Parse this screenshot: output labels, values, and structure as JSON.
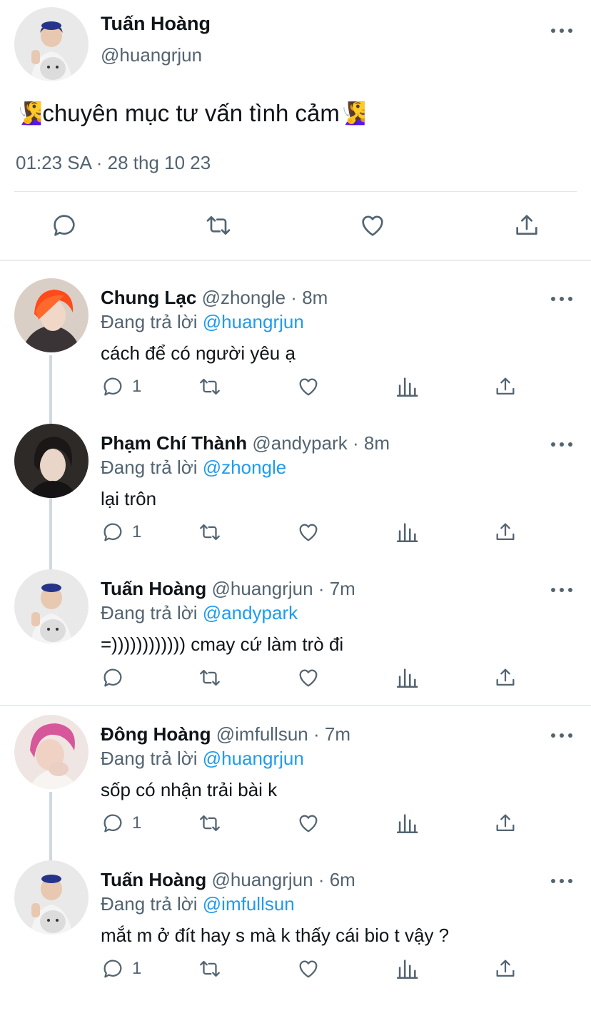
{
  "main_tweet": {
    "name": "Tuấn Hoàng",
    "handle": "@huangrjun",
    "text": "chuyên mục tư vấn tình cảm",
    "emoji_left": "🧏‍♀️",
    "emoji_right": "🧏‍♀️",
    "meta": "01:23 SA · 28 thg 10 23",
    "actions": [
      "reply-icon",
      "retweet-icon",
      "like-icon",
      "share-icon"
    ]
  },
  "replies": [
    {
      "name": "Chung Lạc",
      "handle": "@zhongle",
      "dot": "·",
      "time": "8m",
      "replying_prefix": "Đang trả lời ",
      "replying_to": "@huangrjun",
      "text": "cách để có người yêu ạ",
      "reply_count": "1"
    },
    {
      "name": "Phạm Chí Thành",
      "handle": "@andypark",
      "dot": "·",
      "time": "8m",
      "replying_prefix": "Đang trả lời ",
      "replying_to": "@zhongle",
      "text": "lại trôn",
      "reply_count": "1"
    },
    {
      "name": "Tuấn Hoàng",
      "handle": "@huangrjun",
      "dot": "·",
      "time": "7m",
      "replying_prefix": "Đang trả lời ",
      "replying_to": "@andypark",
      "text": "=)))))))))))) cmay cứ làm trò đi",
      "reply_count": ""
    },
    {
      "name": "Đông Hoàng",
      "handle": "@imfullsun",
      "dot": "·",
      "time": "7m",
      "replying_prefix": "Đang trả lời ",
      "replying_to": "@huangrjun",
      "text": "sốp có nhận trải bài k",
      "reply_count": "1"
    },
    {
      "name": "Tuấn Hoàng",
      "handle": "@huangrjun",
      "dot": "·",
      "time": "6m",
      "replying_prefix": "Đang trả lời ",
      "replying_to": "@imfullsun",
      "text": "mắt m ở đít hay s mà k thấy cái bio t vậy ?",
      "reply_count": "1"
    }
  ],
  "colors": {
    "accent": "#1d9bf0",
    "secondary_text": "#536471",
    "primary_text": "#0f1419",
    "divider": "#e1e6ea",
    "thread_line": "#cfd9de"
  }
}
